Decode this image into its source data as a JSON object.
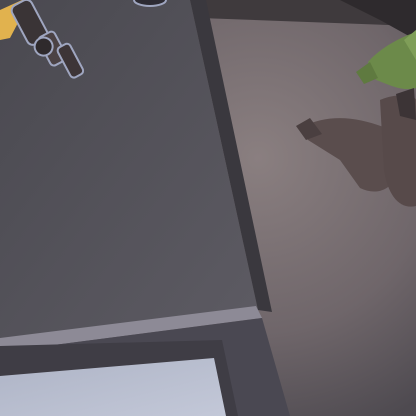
{
  "scene": {
    "view": "top-down",
    "colors": {
      "floor_light": "#8a7f80",
      "floor_mid": "#6f666a",
      "table_top": "#58565e",
      "table_edge": "#8d8a96",
      "monitor_screen": "#b9bfd2",
      "monitor_frame": "#3f3d45",
      "accent_yellow": "#e1b24e",
      "character_skin": "#6c8a4a",
      "character_cloth": "#5a4d4d"
    },
    "objects": [
      {
        "name": "weapon-prop",
        "kind": "rifle"
      },
      {
        "name": "character",
        "kind": "goblin-figure"
      },
      {
        "name": "desk",
        "kind": "table"
      },
      {
        "name": "monitor",
        "kind": "screen"
      }
    ]
  }
}
